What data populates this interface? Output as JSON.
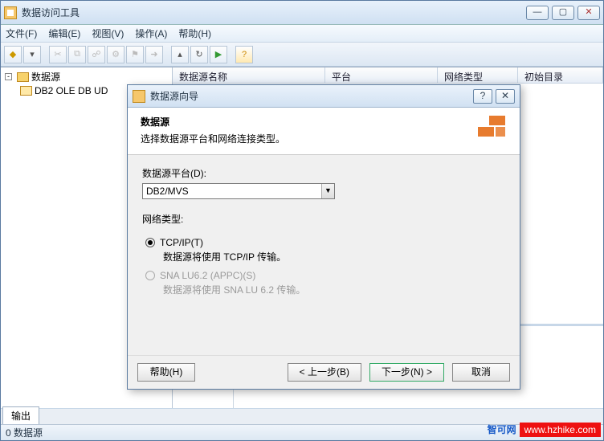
{
  "window": {
    "title": "数据访问工具"
  },
  "menus": {
    "file": "文件(F)",
    "edit": "编辑(E)",
    "view": "视图(V)",
    "action": "操作(A)",
    "help": "帮助(H)"
  },
  "tree": {
    "root": "数据源",
    "child": "DB2 OLE DB UD"
  },
  "columns": {
    "name": "数据源名称",
    "platform": "平台",
    "nettype": "网络类型",
    "catalog": "初始目录"
  },
  "tabs": {
    "output": "输出"
  },
  "status": {
    "text": "0 数据源"
  },
  "dialog": {
    "title": "数据源向导",
    "heading": "数据源",
    "subheading": "选择数据源平台和网络连接类型。",
    "platform_label": "数据源平台(D):",
    "platform_value": "DB2/MVS",
    "nettype_label": "网络类型:",
    "radio1_label": "TCP/IP(T)",
    "radio1_desc": "数据源将使用 TCP/IP 传输。",
    "radio2_label": "SNA LU6.2 (APPC)(S)",
    "radio2_desc": "数据源将使用 SNA LU 6.2 传输。",
    "btn_help": "帮助(H)",
    "btn_back": "< 上一步(B)",
    "btn_next": "下一步(N) >",
    "btn_cancel": "取消"
  },
  "watermark": {
    "brand": "智可网",
    "url": "www.hzhike.com"
  }
}
